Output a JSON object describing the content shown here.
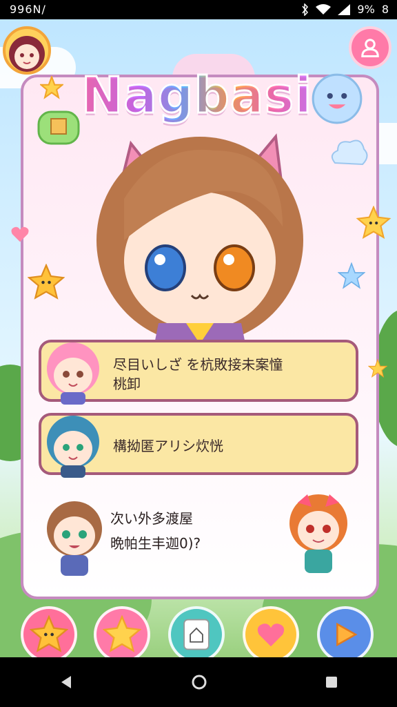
{
  "status_bar": {
    "left_text": "996N/",
    "battery_text": "9%",
    "right_digit": "8"
  },
  "game": {
    "title": "Nagbasi",
    "options": [
      {
        "text_line1": "尽目いしざ を杭敗接未案憧",
        "text_line2": "桃卸"
      },
      {
        "text_line1": "構拗匿アリシ炊恍",
        "text_line2": ""
      }
    ],
    "question": {
      "line1": "次い外多渡屋",
      "line2": "晩帕生丰迦0)?"
    }
  },
  "icons": {
    "avatar": "avatar-icon",
    "profile": "user-icon",
    "bottom_buttons": [
      "star-face-icon",
      "star-icon",
      "house-card-icon",
      "heart-icon",
      "play-icon"
    ],
    "nav": [
      "back-icon",
      "home-icon",
      "recents-icon"
    ]
  },
  "colors": {
    "card_border": "#c58bbf",
    "option_fill": "#fbe7a4",
    "option_border": "#a55a7a",
    "profile_button": "#ff7aa8"
  }
}
